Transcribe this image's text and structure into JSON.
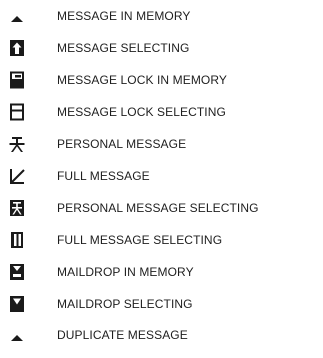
{
  "legend": {
    "items": [
      {
        "icon": "triangle-up-icon",
        "label": "MESSAGE IN MEMORY"
      },
      {
        "icon": "message-selecting-icon",
        "label": "MESSAGE SELECTING"
      },
      {
        "icon": "message-lock-memory-icon",
        "label": "MESSAGE LOCK IN MEMORY"
      },
      {
        "icon": "message-lock-selecting-icon",
        "label": "MESSAGE LOCK SELECTING"
      },
      {
        "icon": "person-icon",
        "label": "PERSONAL MESSAGE"
      },
      {
        "icon": "full-message-icon",
        "label": "FULL MESSAGE"
      },
      {
        "icon": "personal-message-selecting-icon",
        "label": "PERSONAL MESSAGE SELECTING"
      },
      {
        "icon": "full-message-selecting-icon",
        "label": "FULL MESSAGE SELECTING"
      },
      {
        "icon": "maildrop-memory-icon",
        "label": "MAILDROP IN MEMORY"
      },
      {
        "icon": "maildrop-selecting-icon",
        "label": "MAILDROP SELECTING"
      },
      {
        "icon": "duplicate-message-icon",
        "label": "DUPLICATE MESSAGE"
      }
    ]
  }
}
